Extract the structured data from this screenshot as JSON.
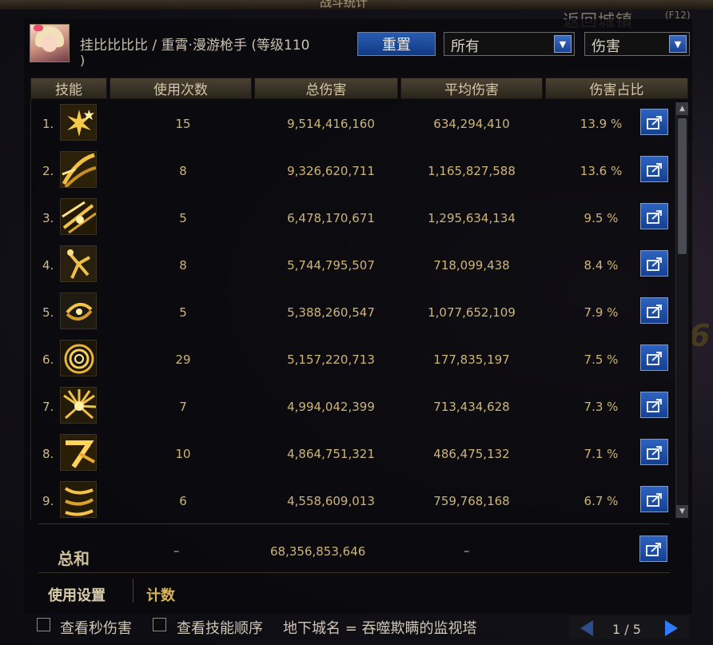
{
  "window": {
    "title": "战斗统计",
    "return_town": "返回城镇",
    "hotkey": "(F12)",
    "deco_number": "6"
  },
  "character": {
    "name_line": "挂比比比比 / 重霄·漫游枪手 (等级110",
    "close_paren": ")"
  },
  "controls": {
    "reset_label": "重置",
    "filter_select": "所有",
    "metric_select": "伤害"
  },
  "columns": [
    "技能",
    "使用次数",
    "总伤害",
    "平均伤害",
    "伤害占比"
  ],
  "skills": [
    {
      "index": "1.",
      "icon": "sparkle-burst-icon",
      "count": "15",
      "total": "9,514,416,160",
      "avg": "634,294,410",
      "pct": "13.9 %"
    },
    {
      "index": "2.",
      "icon": "chain-sweep-icon",
      "count": "8",
      "total": "9,326,620,711",
      "avg": "1,165,827,588",
      "pct": "13.6 %"
    },
    {
      "index": "3.",
      "icon": "slash-storm-icon",
      "count": "5",
      "total": "6,478,170,671",
      "avg": "1,295,634,134",
      "pct": "9.5 %"
    },
    {
      "index": "4.",
      "icon": "gunner-leap-icon",
      "count": "8",
      "total": "5,744,795,507",
      "avg": "718,099,438",
      "pct": "8.4 %"
    },
    {
      "index": "5.",
      "icon": "spin-shot-icon",
      "count": "5",
      "total": "5,388,260,547",
      "avg": "1,077,652,109",
      "pct": "7.9 %"
    },
    {
      "index": "6.",
      "icon": "ring-vortex-icon",
      "count": "29",
      "total": "5,157,220,713",
      "avg": "177,835,197",
      "pct": "7.5 %"
    },
    {
      "index": "7.",
      "icon": "radial-blast-icon",
      "count": "7",
      "total": "4,994,042,399",
      "avg": "713,434,628",
      "pct": "7.3 %"
    },
    {
      "index": "8.",
      "icon": "seven-kick-icon",
      "count": "10",
      "total": "4,864,751,321",
      "avg": "486,475,132",
      "pct": "7.1 %"
    },
    {
      "index": "9.",
      "icon": "chain-strike-icon",
      "count": "6",
      "total": "4,558,609,013",
      "avg": "759,768,168",
      "pct": "6.7 %"
    }
  ],
  "totals": {
    "label": "总和",
    "count": "–",
    "total": "68,356,853,646",
    "avg": "–"
  },
  "tabs": {
    "settings": "使用设置",
    "count": "计数"
  },
  "options": {
    "per_second": "查看秒伤害",
    "skill_order": "查看技能顺序",
    "dungeon": "地下城名 = 吞噬欺瞒的监视塔"
  },
  "pager": {
    "text": "1 / 5"
  },
  "colors": {
    "gold_text": "#cdb478",
    "button_blue": "#2f63bf",
    "pager_active": "#2f7bff"
  }
}
